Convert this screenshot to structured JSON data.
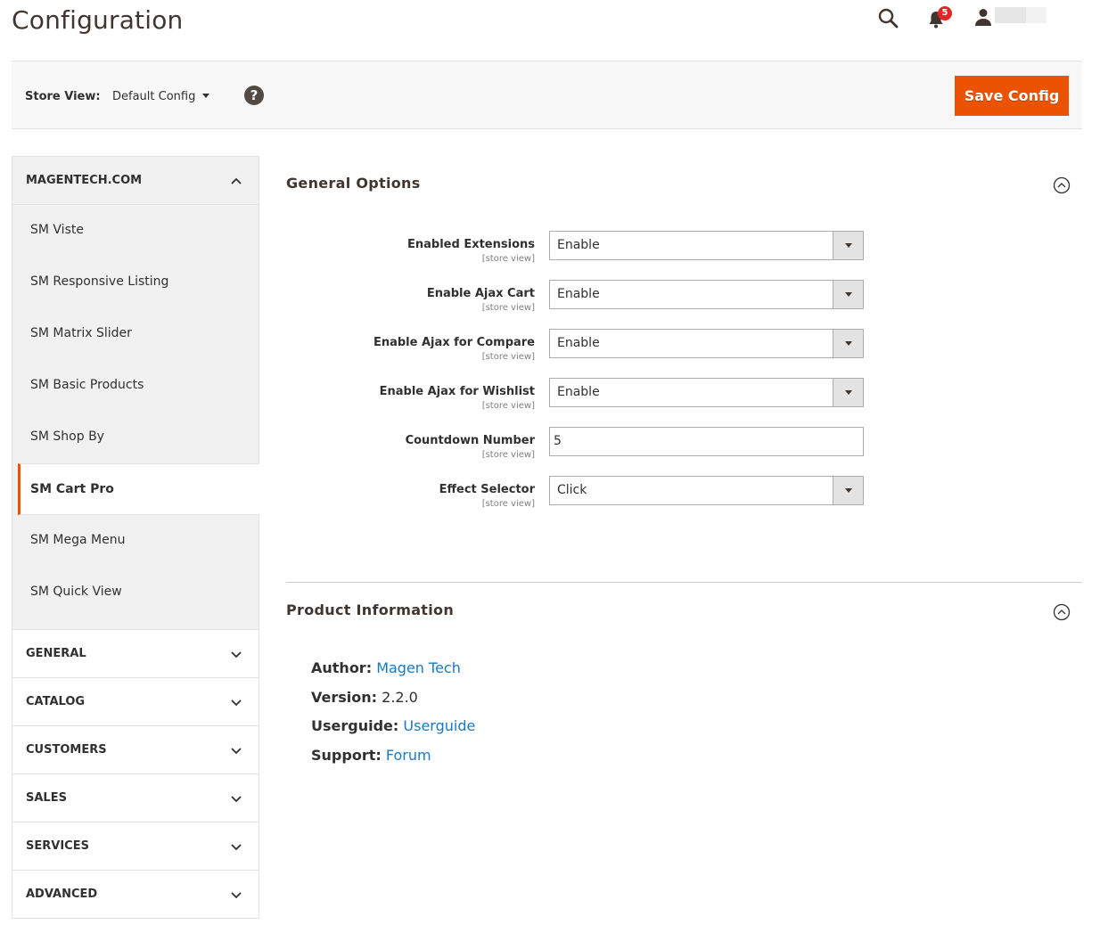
{
  "page": {
    "title": "Configuration"
  },
  "header": {
    "notifications_count": "5",
    "colors": {
      "badge": "#e22626",
      "accent": "#eb5202",
      "link": "#1979c3"
    }
  },
  "store_bar": {
    "label": "Store View:",
    "selected": "Default Config",
    "help_symbol": "?",
    "save_label": "Save Config"
  },
  "sidebar": {
    "active_section": {
      "title": "MAGENTECH.COM",
      "items": [
        {
          "label": "SM Viste"
        },
        {
          "label": "SM Responsive Listing"
        },
        {
          "label": "SM Matrix Slider"
        },
        {
          "label": "SM Basic Products"
        },
        {
          "label": "SM Shop By"
        },
        {
          "label": "SM Cart Pro"
        },
        {
          "label": "SM Mega Menu"
        },
        {
          "label": "SM Quick View"
        }
      ]
    },
    "groups": [
      {
        "label": "GENERAL"
      },
      {
        "label": "CATALOG"
      },
      {
        "label": "CUSTOMERS"
      },
      {
        "label": "SALES"
      },
      {
        "label": "SERVICES"
      },
      {
        "label": "ADVANCED"
      }
    ]
  },
  "general_options": {
    "title": "General Options",
    "fields": [
      {
        "label": "Enabled Extensions",
        "scope": "[store view]",
        "type": "select",
        "value": "Enable"
      },
      {
        "label": "Enable Ajax Cart",
        "scope": "[store view]",
        "type": "select",
        "value": "Enable"
      },
      {
        "label": "Enable Ajax for Compare",
        "scope": "[store view]",
        "type": "select",
        "value": "Enable"
      },
      {
        "label": "Enable Ajax for Wishlist",
        "scope": "[store view]",
        "type": "select",
        "value": "Enable"
      },
      {
        "label": "Countdown Number",
        "scope": "[store view]",
        "type": "text",
        "value": "5"
      },
      {
        "label": "Effect Selector",
        "scope": "[store view]",
        "type": "select",
        "value": "Click"
      }
    ]
  },
  "product_information": {
    "title": "Product Information",
    "author_key": "Author:",
    "author_value": "Magen Tech",
    "version_key": "Version:",
    "version_value": "2.2.0",
    "userguide_key": "Userguide:",
    "userguide_value": "Userguide",
    "support_key": "Support:",
    "support_value": "Forum"
  }
}
